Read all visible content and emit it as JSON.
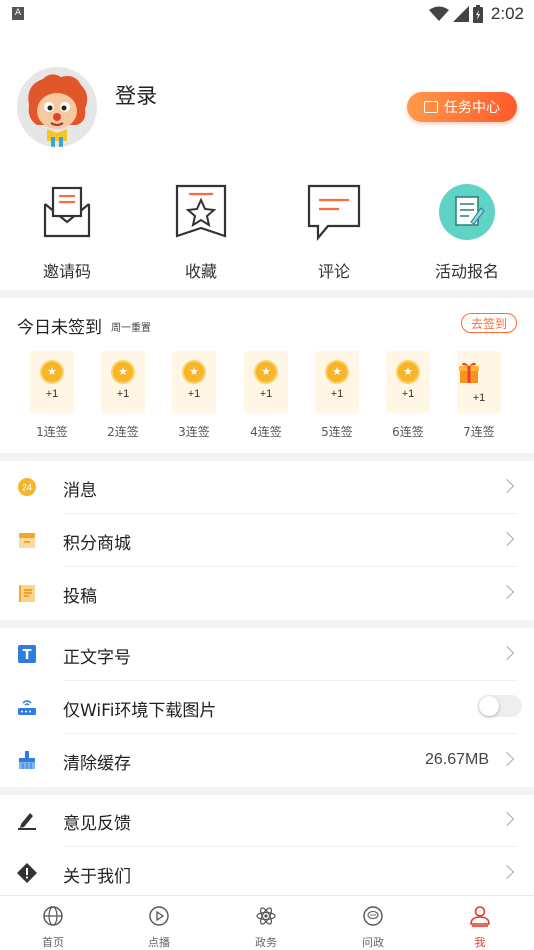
{
  "status_bar": {
    "notification_icon": "A",
    "time": "2:02"
  },
  "profile": {
    "login_label": "登录",
    "task_center_label": "任务中心"
  },
  "quick_actions": [
    {
      "label": "邀请码",
      "icon": "envelope-icon"
    },
    {
      "label": "收藏",
      "icon": "star-bookmark-icon"
    },
    {
      "label": "评论",
      "icon": "comment-icon"
    },
    {
      "label": "活动报名",
      "icon": "form-icon"
    }
  ],
  "sign_in": {
    "title": "今日未签到",
    "subtitle": "周一重置",
    "button_label": "去签到",
    "days": [
      {
        "reward": "+1",
        "label": "1连签",
        "icon": "coin-icon"
      },
      {
        "reward": "+1",
        "label": "2连签",
        "icon": "coin-icon"
      },
      {
        "reward": "+1",
        "label": "3连签",
        "icon": "coin-icon"
      },
      {
        "reward": "+1",
        "label": "4连签",
        "icon": "coin-icon"
      },
      {
        "reward": "+1",
        "label": "5连签",
        "icon": "coin-icon"
      },
      {
        "reward": "+1",
        "label": "6连签",
        "icon": "coin-icon"
      },
      {
        "reward": "+1",
        "label": "7连签",
        "icon": "gift-icon"
      }
    ]
  },
  "menu_group_1": [
    {
      "label": "消息",
      "icon": "message-badge-icon",
      "badge": "24"
    },
    {
      "label": "积分商城",
      "icon": "shop-icon"
    },
    {
      "label": "投稿",
      "icon": "document-icon"
    }
  ],
  "menu_group_2": [
    {
      "label": "正文字号",
      "icon": "font-size-icon"
    },
    {
      "label": "仅WiFi环境下载图片",
      "icon": "router-icon",
      "toggle_on": false
    },
    {
      "label": "清除缓存",
      "icon": "broom-icon",
      "value": "26.67MB"
    }
  ],
  "menu_group_3": [
    {
      "label": "意见反馈",
      "icon": "pencil-icon"
    },
    {
      "label": "关于我们",
      "icon": "info-diamond-icon"
    }
  ],
  "bottom_nav": [
    {
      "label": "首页",
      "icon": "globe-icon",
      "active": false
    },
    {
      "label": "点播",
      "icon": "play-icon",
      "active": false
    },
    {
      "label": "政务",
      "icon": "atom-icon",
      "active": false
    },
    {
      "label": "问政",
      "icon": "chat-icon",
      "active": false
    },
    {
      "label": "我",
      "icon": "person-icon",
      "active": true
    }
  ],
  "colors": {
    "accent": "#ff6a3a",
    "active_nav": "#e43c2f",
    "coin": "#f7b52a",
    "divider": "#f3f3f3"
  }
}
